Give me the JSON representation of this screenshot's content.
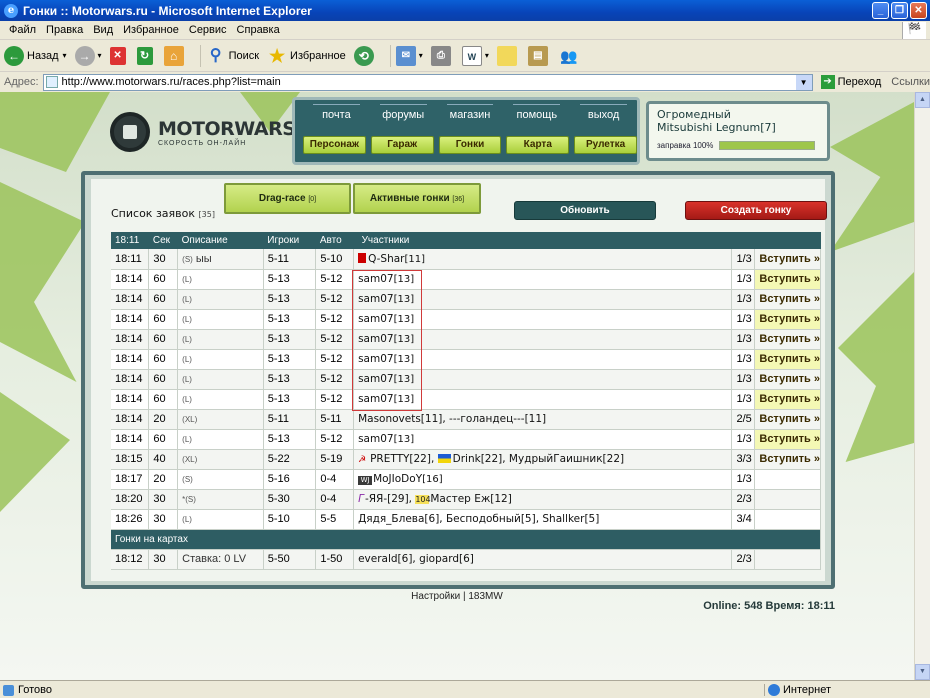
{
  "window": {
    "title": "Гонки :: Motorwars.ru - Microsoft Internet Explorer"
  },
  "menu": [
    "Файл",
    "Правка",
    "Вид",
    "Избранное",
    "Сервис",
    "Справка"
  ],
  "toolbar": {
    "back": "Назад",
    "search": "Поиск",
    "favorites": "Избранное"
  },
  "address": {
    "label": "Адрес:",
    "url": "http://www.motorwars.ru/races.php?list=main",
    "go": "Переход",
    "links": "Ссылки"
  },
  "status": {
    "left": "Готово",
    "zone": "Интернет"
  },
  "site": {
    "brand": "MOTORWARS.RU",
    "tagline": "СКОРОСТЬ ОН-ЛАЙН",
    "nav_top": [
      "почта",
      "форумы",
      "магазин",
      "помощь",
      "выход"
    ],
    "nav_bottom": [
      "Персонаж",
      "Гараж",
      "Гонки",
      "Карта",
      "Рулетка"
    ],
    "car": {
      "line1": "Огромедный",
      "line2": "Mitsubishi Legnum[7]",
      "fuel_label": "заправка 100%",
      "fuel_fraction": 1.0
    },
    "list_label": "Список заявок",
    "list_count": "[35]",
    "tab_drag": "Drag-race",
    "tab_drag_count": "[0]",
    "tab_active": "Активные гонки",
    "tab_active_count": "[36]",
    "refresh": "Обновить",
    "create": "Создать гонку",
    "headers": [
      "18:11",
      "Сек",
      "Описание",
      "Игроки",
      "Авто",
      "Участники"
    ],
    "join_label": "Вступить »",
    "rows": [
      {
        "time": "18:11",
        "sec": "30",
        "type": "(S)",
        "desc": " ыы",
        "players": "5-11",
        "auto": "5-10",
        "part": "Q-Shar",
        "lvl": "[11]",
        "count": "1/3"
      },
      {
        "time": "18:14",
        "sec": "60",
        "type": "(L)",
        "desc": "",
        "players": "5-13",
        "auto": "5-12",
        "part": "sam07",
        "lvl": "[13]",
        "count": "1/3"
      },
      {
        "time": "18:14",
        "sec": "60",
        "type": "(L)",
        "desc": "",
        "players": "5-13",
        "auto": "5-12",
        "part": "sam07",
        "lvl": "[13]",
        "count": "1/3"
      },
      {
        "time": "18:14",
        "sec": "60",
        "type": "(L)",
        "desc": "",
        "players": "5-13",
        "auto": "5-12",
        "part": "sam07",
        "lvl": "[13]",
        "count": "1/3"
      },
      {
        "time": "18:14",
        "sec": "60",
        "type": "(L)",
        "desc": "",
        "players": "5-13",
        "auto": "5-12",
        "part": "sam07",
        "lvl": "[13]",
        "count": "1/3"
      },
      {
        "time": "18:14",
        "sec": "60",
        "type": "(L)",
        "desc": "",
        "players": "5-13",
        "auto": "5-12",
        "part": "sam07",
        "lvl": "[13]",
        "count": "1/3"
      },
      {
        "time": "18:14",
        "sec": "60",
        "type": "(L)",
        "desc": "",
        "players": "5-13",
        "auto": "5-12",
        "part": "sam07",
        "lvl": "[13]",
        "count": "1/3"
      },
      {
        "time": "18:14",
        "sec": "60",
        "type": "(L)",
        "desc": "",
        "players": "5-13",
        "auto": "5-12",
        "part": "sam07",
        "lvl": "[13]",
        "count": "1/3"
      },
      {
        "time": "18:14",
        "sec": "20",
        "type": "(XL)",
        "desc": "",
        "players": "5-11",
        "auto": "5-11",
        "part": "Masonovets[11], ---голандец---[11]",
        "lvl": "",
        "count": "2/5"
      },
      {
        "time": "18:14",
        "sec": "60",
        "type": "(L)",
        "desc": "",
        "players": "5-13",
        "auto": "5-12",
        "part": "sam07",
        "lvl": "[13]",
        "count": "1/3"
      },
      {
        "time": "18:15",
        "sec": "40",
        "type": "(XL)",
        "desc": "",
        "players": "5-22",
        "auto": "5-19",
        "part": "PRETTY[22], Drink[22], МудрыйГаишник[22]",
        "lvl": "",
        "count": "3/3"
      },
      {
        "time": "18:17",
        "sec": "20",
        "type": "(S)",
        "desc": "",
        "players": "5-16",
        "auto": "0-4",
        "part": "MoJIoDoY",
        "lvl": "[16]",
        "count": "1/3"
      },
      {
        "time": "18:20",
        "sec": "30",
        "type": "*(S)",
        "desc": "",
        "players": "5-30",
        "auto": "0-4",
        "part": "-ЯЯ-[29], Мастер Еж[12]",
        "lvl": "",
        "count": "2/3"
      },
      {
        "time": "18:26",
        "sec": "30",
        "type": "(L)",
        "desc": "",
        "players": "5-10",
        "auto": "5-5",
        "part": "Дядя_Блева[6], Бесподобный[5], Shallker[5]",
        "lvl": "",
        "count": "3/4"
      }
    ],
    "section_maps": "Гонки на картах",
    "map_row": {
      "time": "18:12",
      "sec": "30",
      "desc": "Ставка: 0 LV",
      "players": "5-50",
      "auto": "1-50",
      "part": "everald[6], giopard[6]",
      "count": "2/3"
    },
    "footer": "Настройки | 183MW",
    "online": "Online: 548  Время: 18:11",
    "clan_tag_1": "WJ",
    "clan_tag_2": "104",
    "clan_tag_3": "Г"
  }
}
